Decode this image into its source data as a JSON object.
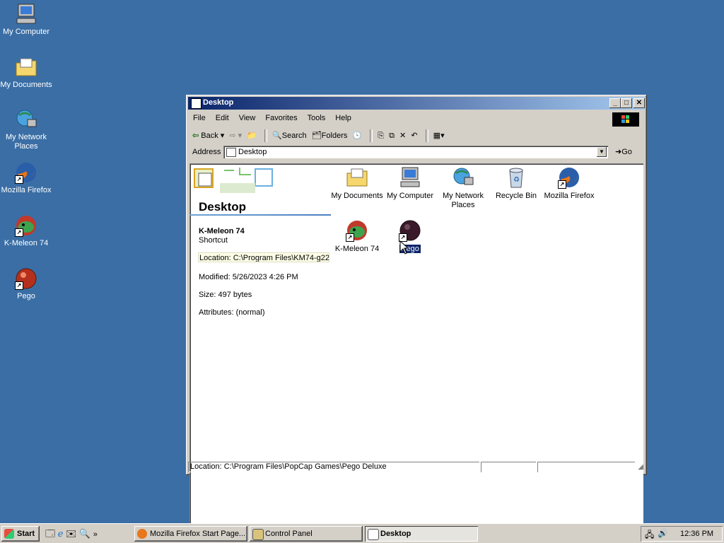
{
  "desktop": {
    "icons": [
      {
        "label": "My Computer",
        "icon": "my-computer-icon"
      },
      {
        "label": "My Documents",
        "icon": "my-documents-icon"
      },
      {
        "label": "My Network Places",
        "icon": "network-places-icon"
      },
      {
        "label": "Mozilla Firefox",
        "icon": "firefox-icon"
      },
      {
        "label": "K-Meleon 74",
        "icon": "k-meleon-icon"
      },
      {
        "label": "Pego",
        "icon": "pego-icon"
      }
    ]
  },
  "window": {
    "title": "Desktop",
    "menu": [
      "File",
      "Edit",
      "View",
      "Favorites",
      "Tools",
      "Help"
    ],
    "toolbar": {
      "back": "Back",
      "search": "Search",
      "folders": "Folders"
    },
    "address": {
      "label": "Address",
      "value": "Desktop",
      "go": "Go"
    },
    "panel": {
      "heading": "Desktop",
      "item_name": "K-Meleon 74",
      "item_type": "Shortcut",
      "location": "Location: C:\\Program Files\\KM74-g22",
      "modified": "Modified: 5/26/2023 4:26 PM",
      "size": "Size: 497 bytes",
      "attributes": "Attributes: (normal)"
    },
    "items": [
      {
        "label": "My Documents",
        "icon": "my-documents-icon"
      },
      {
        "label": "My Computer",
        "icon": "my-computer-icon"
      },
      {
        "label": "My Network Places",
        "icon": "network-places-icon"
      },
      {
        "label": "Recycle Bin",
        "icon": "recycle-bin-icon"
      },
      {
        "label": "Mozilla Firefox",
        "icon": "firefox-icon"
      },
      {
        "label": "K-Meleon 74",
        "icon": "k-meleon-icon"
      },
      {
        "label": "Pego",
        "icon": "pego-icon",
        "selected": true
      }
    ],
    "status": "Location: C:\\Program Files\\PopCap Games\\Pego Deluxe"
  },
  "taskbar": {
    "start": "Start",
    "buttons": [
      {
        "label": "Mozilla Firefox Start Page...",
        "active": false
      },
      {
        "label": "Control Panel",
        "active": false
      },
      {
        "label": "Desktop",
        "active": true
      }
    ],
    "clock": "12:36 PM"
  },
  "colors": {
    "desktop": "#3a6ea5",
    "titlebar": "#0a246a",
    "selection": "#0a246a"
  }
}
